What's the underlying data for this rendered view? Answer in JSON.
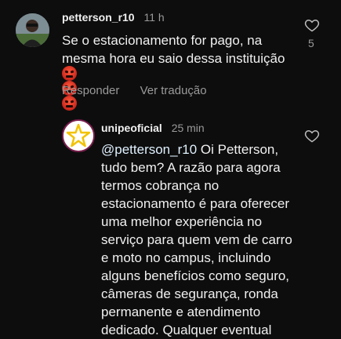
{
  "comment": {
    "username": "petterson_r10",
    "time": "11 h",
    "text": "Se o estacionamento for pago, na mesma hora eu saio dessa instituição",
    "emoji_count": 3,
    "emoji_icon": "enraged-face-icon",
    "likes": "5",
    "reply_label": "Responder",
    "translate_label": "Ver tradução"
  },
  "reply": {
    "username": "unipeoficial",
    "time": "25 min",
    "mention": "@petterson_r10",
    "text": " Oi Petterson, tudo bem? A razão para agora termos cobrança no estacionamento é para oferecer uma melhor experiência no serviço para quem vem de carro e moto no campus, incluindo alguns benefícios como seguro, câmeras de segurança, ronda permanente e atendimento dedicado. Qualquer eventual"
  },
  "colors": {
    "background": "#0d0d0d",
    "text": "#f0f0f0",
    "muted": "#9a9a9a",
    "brand_star": "#f2c200"
  }
}
